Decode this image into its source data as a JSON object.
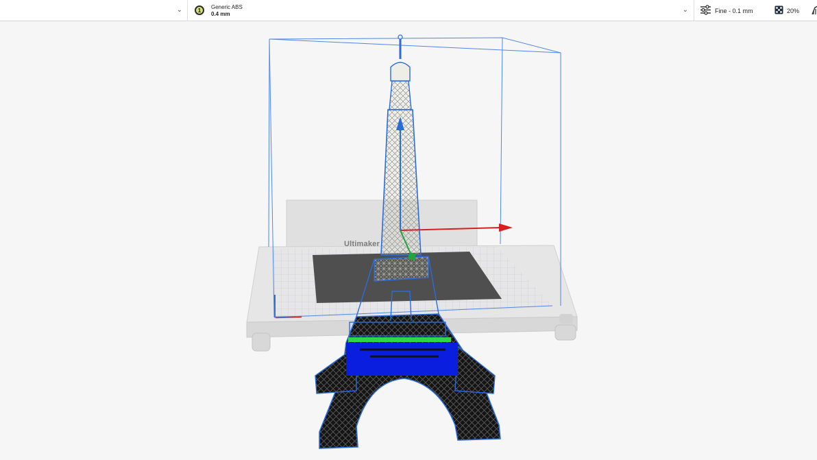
{
  "toolbar": {
    "extruder_number": "1",
    "material_name": "Generic ABS",
    "nozzle_size": "0.4 mm",
    "print_profile": "Fine - 0.1 mm",
    "infill": "20%"
  },
  "viewport": {
    "plate_label": "Ultimaker"
  },
  "colors": {
    "selection_outline": "#2b6cdb",
    "axis_x": "#d62020",
    "axis_y": "#22a53c",
    "axis_z": "#2b6cdb",
    "build_plate": "#e3e3e3",
    "printable_area": "#4a4a4a",
    "model_body": "#ecece4",
    "model_below_plate": "#111111",
    "overhang_fill": "#0a1ee0"
  },
  "icons": [
    "chevron-down-icon",
    "extruder-badge-icon",
    "settings-sliders-icon",
    "infill-icon",
    "support-icon"
  ]
}
